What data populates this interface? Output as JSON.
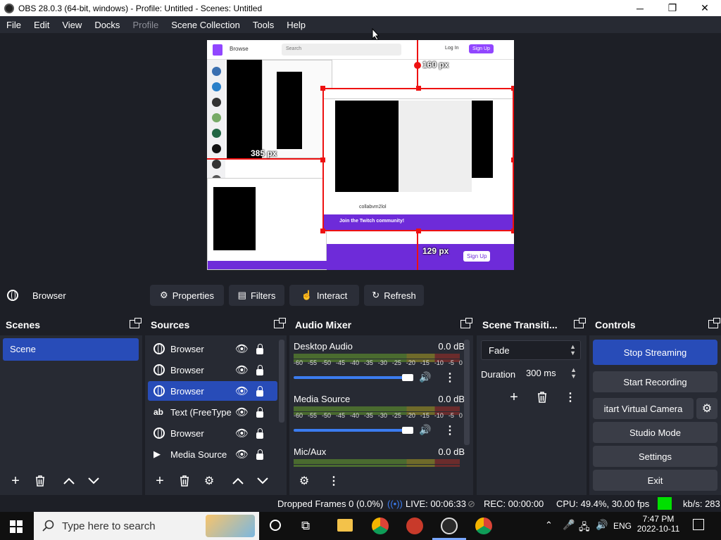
{
  "window": {
    "title": "OBS 28.0.3 (64-bit, windows) - Profile: Untitled - Scenes: Untitled",
    "minimize": "─",
    "maximize": "❐",
    "close": "✕"
  },
  "menu": [
    "File",
    "Edit",
    "View",
    "Docks",
    "Profile",
    "Scene Collection",
    "Tools",
    "Help"
  ],
  "preview": {
    "twitch_browse": "Browse",
    "twitch_search": "Search",
    "twitch_login": "Log In",
    "twitch_signup": "Sign Up",
    "twitch_channel": "collabvm2lol",
    "twitch_join": "Join the Twitch community!",
    "twitch_signup_bottom": "Sign Up",
    "guide_top": "160 px",
    "guide_left": "385 px",
    "guide_bottom": "129 px"
  },
  "source_toolbar": {
    "source_name": "Browser",
    "properties": "Properties",
    "filters": "Filters",
    "interact": "Interact",
    "refresh": "Refresh"
  },
  "scenes": {
    "title": "Scenes",
    "items": [
      "Scene"
    ]
  },
  "sources": {
    "title": "Sources",
    "items": [
      {
        "label": "Browser",
        "type": "browser",
        "selected": false
      },
      {
        "label": "Browser",
        "type": "browser",
        "selected": false
      },
      {
        "label": "Browser",
        "type": "browser",
        "selected": true
      },
      {
        "label": "Text (FreeType",
        "type": "text",
        "selected": false
      },
      {
        "label": "Browser",
        "type": "browser",
        "selected": false
      },
      {
        "label": "Media Source",
        "type": "media",
        "selected": false
      }
    ]
  },
  "audio_mixer": {
    "title": "Audio Mixer",
    "ticks": [
      "-60",
      "-55",
      "-50",
      "-45",
      "-40",
      "-35",
      "-30",
      "-25",
      "-20",
      "-15",
      "-10",
      "-5",
      "0"
    ],
    "channels": [
      {
        "name": "Desktop Audio",
        "db": "0.0 dB"
      },
      {
        "name": "Media Source",
        "db": "0.0 dB"
      },
      {
        "name": "Mic/Aux",
        "db": "0.0 dB"
      }
    ]
  },
  "scene_transitions": {
    "title": "Scene Transiti...",
    "transition": "Fade",
    "duration_label": "Duration",
    "duration_value": "300 ms"
  },
  "controls": {
    "title": "Controls",
    "stop_streaming": "Stop Streaming",
    "start_recording": "Start Recording",
    "start_virtual_camera": "itart Virtual Camera",
    "studio_mode": "Studio Mode",
    "settings": "Settings",
    "exit": "Exit"
  },
  "status": {
    "dropped_frames": "Dropped Frames 0 (0.0%)",
    "live": "LIVE: 00:06:33",
    "rec": "REC: 00:00:00",
    "cpu": "CPU: 49.4%, 30.00 fps",
    "kbs": "kb/s: 283",
    "health_color": "#00e000"
  },
  "taskbar": {
    "search_placeholder": "Type here to search",
    "language": "ENG",
    "time": "7:47 PM",
    "date": "2022-10-11"
  },
  "colors": {
    "accent": "#284cb8",
    "twitch_purple": "#9146ff",
    "guide_red": "#e11111"
  }
}
